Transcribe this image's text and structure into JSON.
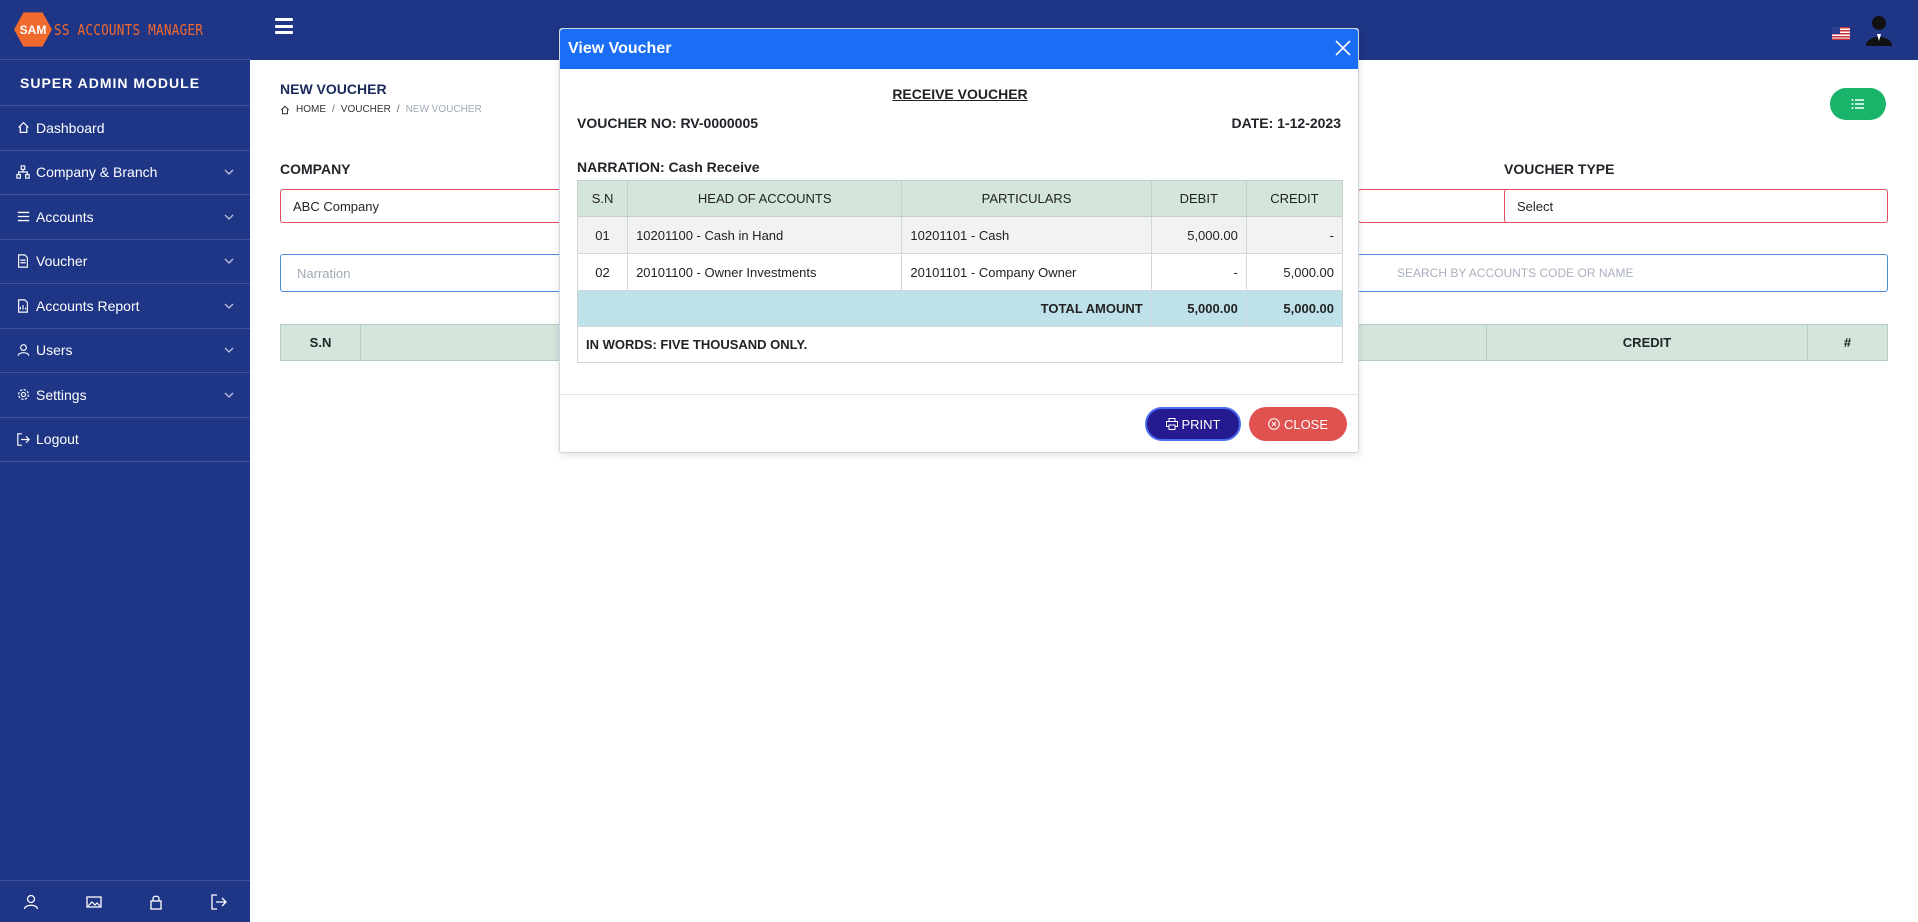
{
  "brand": {
    "logo_text": "SAM",
    "name": "SS ACCOUNTS MANAGER"
  },
  "sidebar": {
    "module_title": "SUPER ADMIN MODULE",
    "items": [
      {
        "label": "Dashboard",
        "icon": "home-icon"
      },
      {
        "label": "Company & Branch",
        "icon": "sitemap-icon"
      },
      {
        "label": "Accounts",
        "icon": "list-icon"
      },
      {
        "label": "Voucher",
        "icon": "file-icon"
      },
      {
        "label": "Accounts Report",
        "icon": "report-icon"
      },
      {
        "label": "Users",
        "icon": "user-icon"
      },
      {
        "label": "Settings",
        "icon": "gear-icon"
      },
      {
        "label": "Logout",
        "icon": "logout-icon"
      }
    ]
  },
  "page": {
    "title": "NEW VOUCHER",
    "breadcrumb": [
      "HOME",
      "VOUCHER",
      "NEW VOUCHER"
    ]
  },
  "form": {
    "company_label": "COMPANY",
    "company_value": "ABC Company",
    "voucher_type_label": "VOUCHER TYPE",
    "voucher_type_value": "Select",
    "narration_placeholder": "Narration",
    "search_placeholder": "SEARCH BY ACCOUNTS CODE OR NAME"
  },
  "main_table": {
    "headers": [
      "S.N",
      "",
      "CREDIT",
      "#"
    ]
  },
  "modal": {
    "title": "View Voucher",
    "voucher_type": "RECEIVE VOUCHER",
    "voucher_no": "VOUCHER NO: RV-0000005",
    "date": "DATE: 1-12-2023",
    "narration": "NARRATION: Cash Receive",
    "columns": [
      "S.N",
      "HEAD OF ACCOUNTS",
      "PARTICULARS",
      "DEBIT",
      "CREDIT"
    ],
    "rows": [
      {
        "sn": "01",
        "head": "10201100 - Cash in Hand",
        "particulars": "10201101 - Cash",
        "debit": "5,000.00",
        "credit": "-"
      },
      {
        "sn": "02",
        "head": "20101100 - Owner Investments",
        "particulars": "20101101 - Company Owner",
        "debit": "-",
        "credit": "5,000.00"
      }
    ],
    "total_label": "TOTAL AMOUNT",
    "total_debit": "5,000.00",
    "total_credit": "5,000.00",
    "in_words": "IN WORDS: FIVE THOUSAND ONLY.",
    "print_label": "PRINT",
    "close_label": "CLOSE"
  },
  "colors": {
    "sidebar_bg": "#1f3585",
    "modal_header": "#1a6ef5",
    "print_btn": "#251a8f",
    "close_btn": "#e0524f",
    "accent_green": "#19b46a",
    "brand_orange": "#f0692d"
  }
}
